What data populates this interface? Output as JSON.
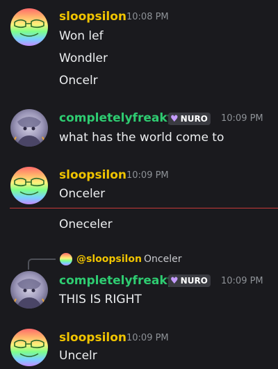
{
  "messages": [
    {
      "username": "sloopsilon",
      "timestamp": "10:08 PM",
      "lines": [
        "Won lef",
        "Wondler",
        "Oncelr"
      ]
    },
    {
      "username": "completelyfreaky",
      "badge": "NURO",
      "timestamp": "10:09 PM",
      "lines": [
        "what has the world come to"
      ]
    },
    {
      "username": "sloopsilon",
      "timestamp": "10:09 PM",
      "lines": [
        "Onceler",
        "Oneceler"
      ]
    },
    {
      "reply": {
        "user": "@sloopsilon",
        "text": "Onceler"
      },
      "username": "completelyfreaky",
      "badge": "NURO",
      "timestamp": "10:09 PM",
      "lines": [
        "THIS IS RIGHT"
      ]
    },
    {
      "username": "sloopsilon",
      "timestamp": "10:09 PM",
      "lines": [
        "Uncelr"
      ]
    }
  ],
  "colors": {
    "background": "#1a1a1e",
    "sloopsilon_name": "#f0c400",
    "freaky_name": "#2ecc71",
    "new_messages_divider": "#c93a3a"
  },
  "icons": {
    "badge_icon": "heart-icon",
    "avatar_sloopsilon": "rainbow-avatar",
    "avatar_freaky": "sketch-avatar"
  }
}
